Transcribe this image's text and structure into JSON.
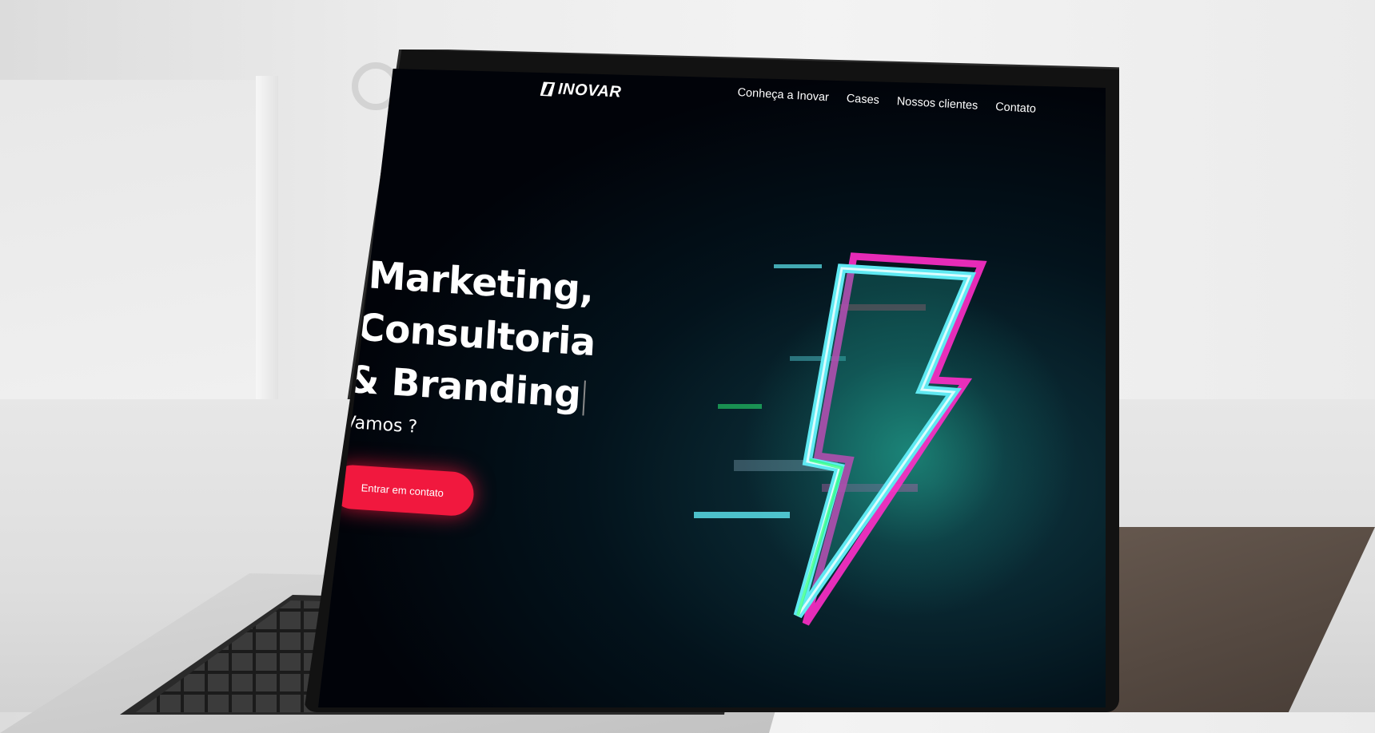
{
  "brand": {
    "logo_text": "INOVAR"
  },
  "nav": {
    "items": [
      {
        "label": "Conheça a Inovar"
      },
      {
        "label": "Cases"
      },
      {
        "label": "Nossos clientes"
      },
      {
        "label": "Contato"
      }
    ]
  },
  "hero": {
    "line1": "Marketing,",
    "line2": "Consultoria",
    "line3": "& Branding",
    "subtitle": "Vamos ?",
    "cta_label": "Entrar em contato"
  },
  "colors": {
    "background": "#010309",
    "accent": "#f1183e",
    "bolt_cyan": "#5fe9f2",
    "bolt_magenta": "#ff2ec8"
  },
  "icons": {
    "hero_visual": "glitch-lightning-bolt-icon",
    "logo_mark": "inovar-logo-mark-icon"
  }
}
